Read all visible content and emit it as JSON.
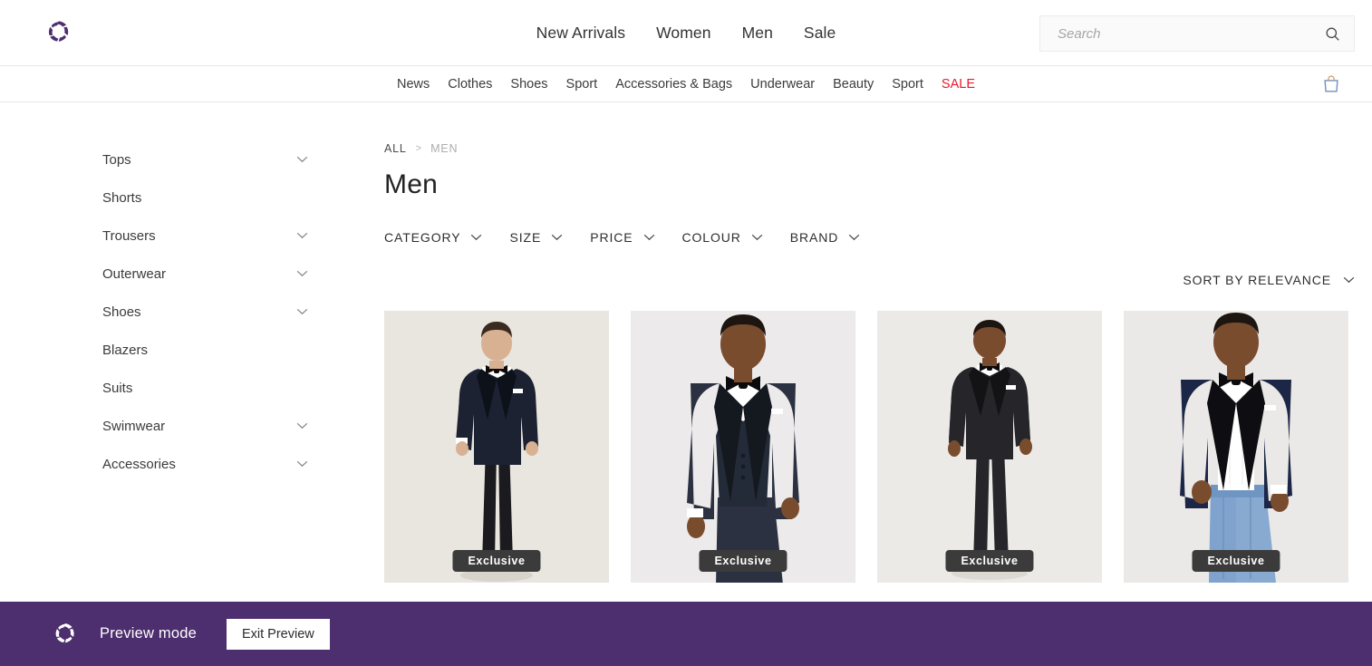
{
  "header": {
    "logo_icon": "pinwheel-logo-icon",
    "brand_color": "#4d2e6e",
    "nav": [
      {
        "label": "New Arrivals"
      },
      {
        "label": "Women"
      },
      {
        "label": "Men"
      },
      {
        "label": "Sale"
      }
    ],
    "search": {
      "placeholder": "Search",
      "value": "",
      "icon": "search-icon"
    }
  },
  "subnav": {
    "items": [
      {
        "label": "News",
        "highlight": false
      },
      {
        "label": "Clothes",
        "highlight": false
      },
      {
        "label": "Shoes",
        "highlight": false
      },
      {
        "label": "Sport",
        "highlight": false
      },
      {
        "label": "Accessories & Bags",
        "highlight": false
      },
      {
        "label": "Underwear",
        "highlight": false
      },
      {
        "label": "Beauty",
        "highlight": false
      },
      {
        "label": "Sport",
        "highlight": false
      },
      {
        "label": "SALE",
        "highlight": true
      }
    ],
    "sale_color": "#e8192c",
    "bag_icon": "shopping-bag-icon"
  },
  "sidebar": {
    "items": [
      {
        "label": "Tops",
        "expandable": true
      },
      {
        "label": "Shorts",
        "expandable": false
      },
      {
        "label": "Trousers",
        "expandable": true
      },
      {
        "label": "Outerwear",
        "expandable": true
      },
      {
        "label": "Shoes",
        "expandable": true
      },
      {
        "label": "Blazers",
        "expandable": false
      },
      {
        "label": "Suits",
        "expandable": false
      },
      {
        "label": "Swimwear",
        "expandable": true
      },
      {
        "label": "Accessories",
        "expandable": true
      }
    ]
  },
  "main": {
    "breadcrumb": {
      "root": "ALL",
      "separator": ">",
      "current": "MEN"
    },
    "title": "Men",
    "filters": [
      {
        "label": "CATEGORY"
      },
      {
        "label": "SIZE"
      },
      {
        "label": "PRICE"
      },
      {
        "label": "COLOUR"
      },
      {
        "label": "BRAND"
      }
    ],
    "sort": {
      "label": "SORT BY RELEVANCE"
    },
    "products": [
      {
        "badge": "Exclusive",
        "alt": "Man in navy pinstripe tuxedo with black bow tie",
        "bg": "#e9e5df",
        "suit_color": "#1d2233",
        "lapel_color": "#0d1119",
        "skin": "#d8b193",
        "hair": "#3a2a1f",
        "crop": "full",
        "trouser_color": "#1a1a1f"
      },
      {
        "badge": "Exclusive",
        "alt": "Man in navy three-piece tuxedo with bow tie",
        "bg": "#eceaea",
        "suit_color": "#2b3141",
        "lapel_color": "#14181f",
        "skin": "#7a4c2e",
        "hair": "#1d1510",
        "crop": "close",
        "trouser_color": "#2b3141"
      },
      {
        "badge": "Exclusive",
        "alt": "Man in black three-piece tuxedo",
        "bg": "#eceae6",
        "suit_color": "#26262a",
        "lapel_color": "#131316",
        "skin": "#7a4c2e",
        "hair": "#1d1510",
        "crop": "full",
        "trouser_color": "#26262a"
      },
      {
        "badge": "Exclusive",
        "alt": "Man in navy velvet dinner jacket with jeans",
        "bg": "#ebe9e7",
        "suit_color": "#1c2747",
        "lapel_color": "#0e0e12",
        "skin": "#7a4c2e",
        "hair": "#1d1510",
        "crop": "jeans",
        "trouser_color": "#7fa3cc"
      }
    ]
  },
  "preview_bar": {
    "logo_icon": "pinwheel-logo-icon",
    "label": "Preview mode",
    "exit_label": "Exit Preview",
    "background": "#4d2e6e"
  }
}
